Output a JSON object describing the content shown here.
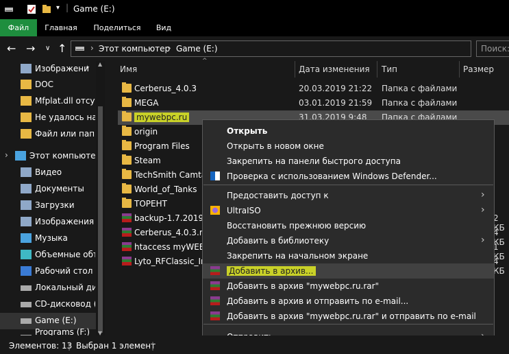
{
  "window": {
    "title": "Game (E:)"
  },
  "ribbon": {
    "tabs": [
      "Файл",
      "Главная",
      "Поделиться",
      "Вид"
    ]
  },
  "address": {
    "segments": [
      "Этот компьютер",
      "Game (E:)"
    ]
  },
  "search": {
    "placeholder": "Поиск:"
  },
  "sidebar": {
    "items": [
      {
        "label": "Изображени",
        "icon": "pictures-icon"
      },
      {
        "label": "DOC",
        "icon": "folder-icon"
      },
      {
        "label": "Mfplat.dll отсуто",
        "icon": "folder-icon"
      },
      {
        "label": "Не удалось най",
        "icon": "folder-icon"
      },
      {
        "label": "Файл или папка",
        "icon": "folder-icon"
      },
      {
        "label": "Этот компьютер",
        "icon": "computer-icon"
      },
      {
        "label": "Видео",
        "icon": "video-icon"
      },
      {
        "label": "Документы",
        "icon": "documents-icon"
      },
      {
        "label": "Загрузки",
        "icon": "downloads-icon"
      },
      {
        "label": "Изображения",
        "icon": "pictures-icon"
      },
      {
        "label": "Музыка",
        "icon": "music-icon"
      },
      {
        "label": "Объемные объ",
        "icon": "3d-objects-icon"
      },
      {
        "label": "Рабочий стол",
        "icon": "desktop-icon"
      },
      {
        "label": "Локальный дис",
        "icon": "drive-icon"
      },
      {
        "label": "CD-дисковод (D",
        "icon": "cd-drive-icon"
      },
      {
        "label": "Game (E:)",
        "icon": "drive-icon"
      },
      {
        "label": "Programs (F:)",
        "icon": "drive-icon"
      }
    ]
  },
  "columns": {
    "name": "Имя",
    "date": "Дата изменения",
    "type": "Тип",
    "size": "Размер"
  },
  "files": [
    {
      "name": "Cerberus_4.0.3",
      "date": "20.03.2019 21:22",
      "type": "Папка с файлами",
      "size": "",
      "icon": "folder-icon"
    },
    {
      "name": "MEGA",
      "date": "03.01.2019 21:59",
      "type": "Папка с файлами",
      "size": "",
      "icon": "folder-icon"
    },
    {
      "name": "mywebpc.ru",
      "date": "31.03.2019 9:48",
      "type": "Папка с файлами",
      "size": "",
      "icon": "folder-icon"
    },
    {
      "name": "origin",
      "date": "",
      "type": "",
      "size": "",
      "icon": "folder-icon"
    },
    {
      "name": "Program Files",
      "date": "",
      "type": "",
      "size": "",
      "icon": "folder-icon"
    },
    {
      "name": "Steam",
      "date": "",
      "type": "",
      "size": "",
      "icon": "folder-icon"
    },
    {
      "name": "TechSmith Camtas",
      "date": "",
      "type": "",
      "size": "",
      "icon": "folder-icon"
    },
    {
      "name": "World_of_Tanks",
      "date": "",
      "type": "",
      "size": "",
      "icon": "folder-icon"
    },
    {
      "name": "ТОРЕНТ",
      "date": "",
      "type": "",
      "size": "",
      "icon": "folder-icon"
    },
    {
      "name": "backup-1.7.2019_16",
      "date": "",
      "type": "",
      "size": "2 КБ",
      "icon": "rar-icon"
    },
    {
      "name": "Cerberus_4.0.3.rar",
      "date": "",
      "type": "",
      "size": "4 КБ",
      "icon": "rar-icon"
    },
    {
      "name": "htaccess myWEBpc",
      "date": "",
      "type": "",
      "size": "1 КБ",
      "icon": "rar-icon"
    },
    {
      "name": "Lyto_RFClassic_Inst",
      "date": "",
      "type": "",
      "size": "4 КБ",
      "icon": "rar-icon"
    }
  ],
  "context_menu": {
    "items": [
      {
        "label": "Открыть",
        "bold": true,
        "icon": ""
      },
      {
        "label": "Открыть в новом окне",
        "icon": ""
      },
      {
        "label": "Закрепить на панели быстрого доступа",
        "icon": ""
      },
      {
        "label": "Проверка с использованием Windows Defender...",
        "icon": "defender-shield-icon"
      },
      {
        "label": "Предоставить доступ к",
        "icon": "",
        "submenu": true
      },
      {
        "label": "UltraISO",
        "icon": "ultraiso-icon",
        "submenu": true
      },
      {
        "label": "Восстановить прежнюю версию",
        "icon": ""
      },
      {
        "label": "Добавить в библиотеку",
        "icon": "",
        "submenu": true
      },
      {
        "label": "Закрепить на начальном экране",
        "icon": ""
      },
      {
        "label": "Добавить в архив...",
        "icon": "winrar-icon",
        "highlighted": true
      },
      {
        "label": "Добавить в архив \"mywebpc.ru.rar\"",
        "icon": "winrar-icon"
      },
      {
        "label": "Добавить в архив и отправить по e-mail...",
        "icon": "winrar-icon"
      },
      {
        "label": "Добавить в архив \"mywebpc.ru.rar\" и отправить по e-mail",
        "icon": "winrar-icon"
      },
      {
        "label": "Отправить",
        "icon": "",
        "submenu": true
      }
    ]
  },
  "status": {
    "count": "Элементов: 13",
    "selected": "Выбран 1 элемент"
  },
  "colors": {
    "accent": "#1e8e3e",
    "highlight": "#c9d128",
    "background": "#191919"
  }
}
